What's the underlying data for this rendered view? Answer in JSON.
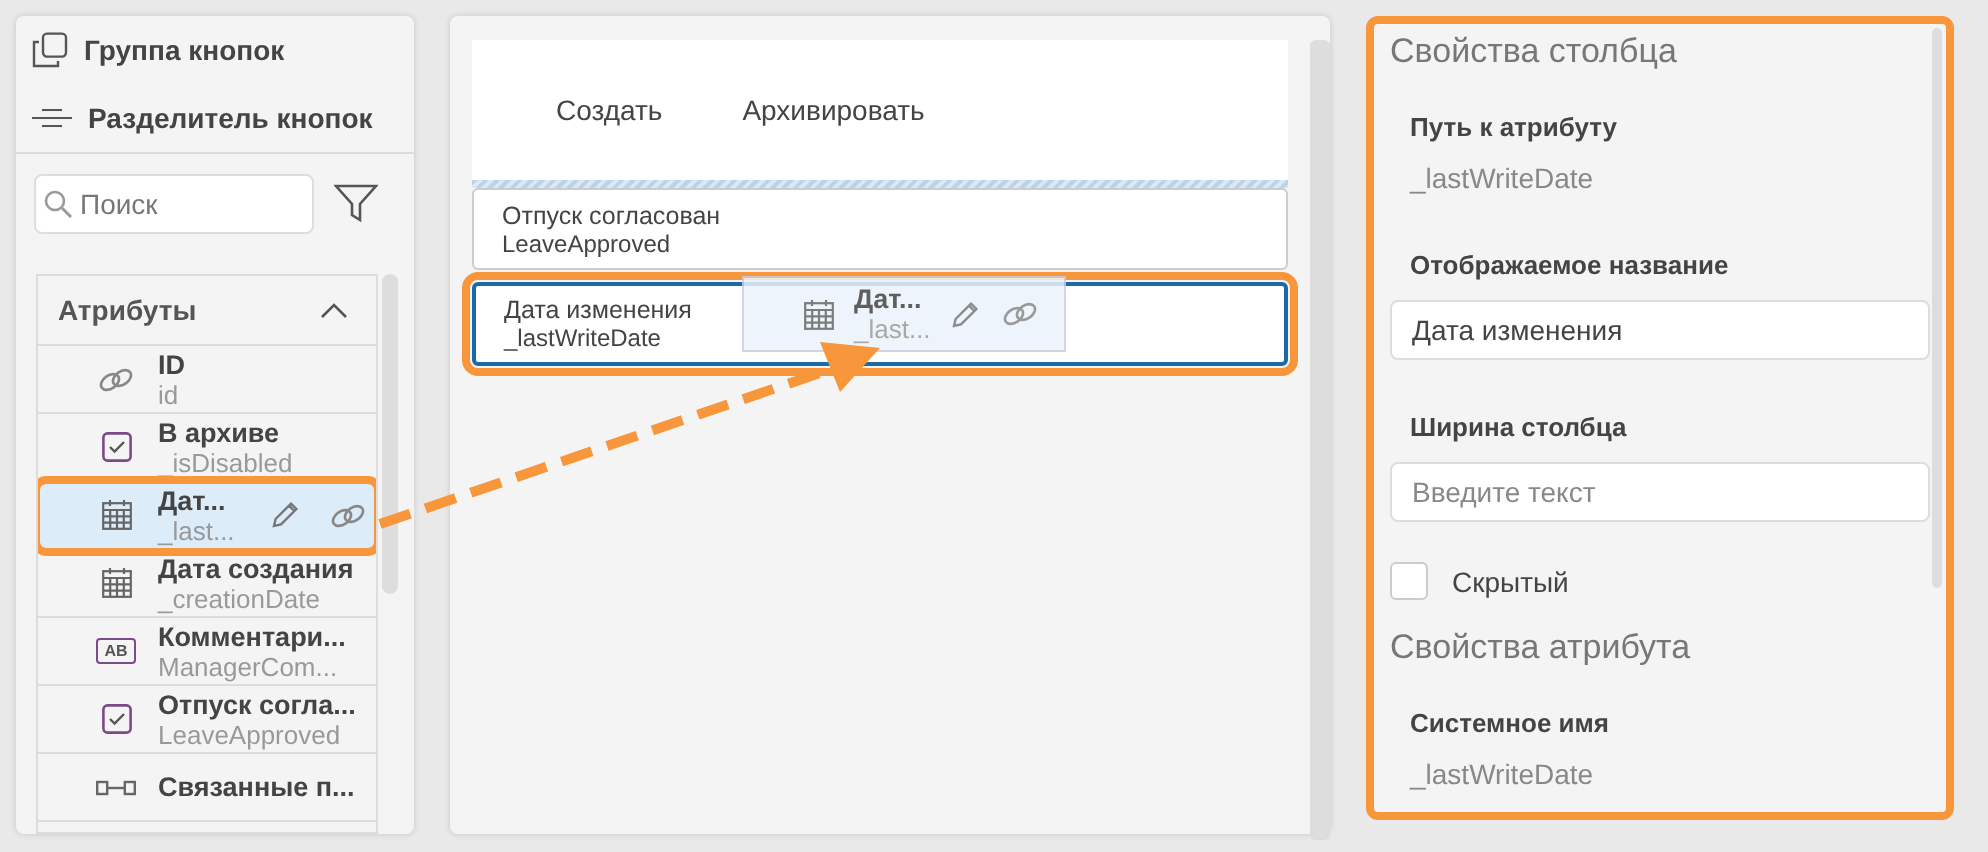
{
  "toolbox": [
    {
      "kind": "group",
      "label": "Группа кнопок"
    },
    {
      "kind": "divider",
      "label": "Разделитель кнопок"
    }
  ],
  "search": {
    "placeholder": "Поиск"
  },
  "attributes": {
    "title": "Атрибуты",
    "expanded": true,
    "items": [
      {
        "kind": "link",
        "name": "ID",
        "system": "id",
        "selected": false
      },
      {
        "kind": "checkbox",
        "name": "В архиве",
        "system": "_isDisabled",
        "selected": false
      },
      {
        "kind": "date",
        "name": "Дат...",
        "system": "_last...",
        "selected": true
      },
      {
        "kind": "date",
        "name": "Дата создания",
        "system": "_creationDate",
        "selected": false
      },
      {
        "kind": "text",
        "icon_label": "AB",
        "name": "Комментари...",
        "system": "ManagerCom...",
        "selected": false
      },
      {
        "kind": "checkbox",
        "name": "Отпуск согла...",
        "system": "LeaveApproved",
        "selected": false
      },
      {
        "kind": "relation",
        "name": "Связанные п...",
        "selected": false
      }
    ]
  },
  "form": {
    "buttons": [
      "Создать",
      "Архивировать"
    ],
    "columns": [
      {
        "title": "Отпуск согласован",
        "path": "LeaveApproved",
        "selected": false
      },
      {
        "title": "Дата изменения",
        "path": "_lastWriteDate",
        "selected": true
      }
    ],
    "drag_preview": {
      "kind": "date",
      "name": "Дат...",
      "system": "_last..."
    }
  },
  "properties": {
    "column_title": "Свойства столбца",
    "path_label": "Путь к атрибуту",
    "path_value": "_lastWriteDate",
    "display_label": "Отображаемое название",
    "display_value": "Дата изменения",
    "width_label": "Ширина столбца",
    "width_placeholder": "Введите текст",
    "hidden": {
      "label": "Скрытый",
      "checked": false
    },
    "attribute_title": "Свойства атрибута",
    "system_label": "Системное имя",
    "system_value": "_lastWriteDate"
  }
}
